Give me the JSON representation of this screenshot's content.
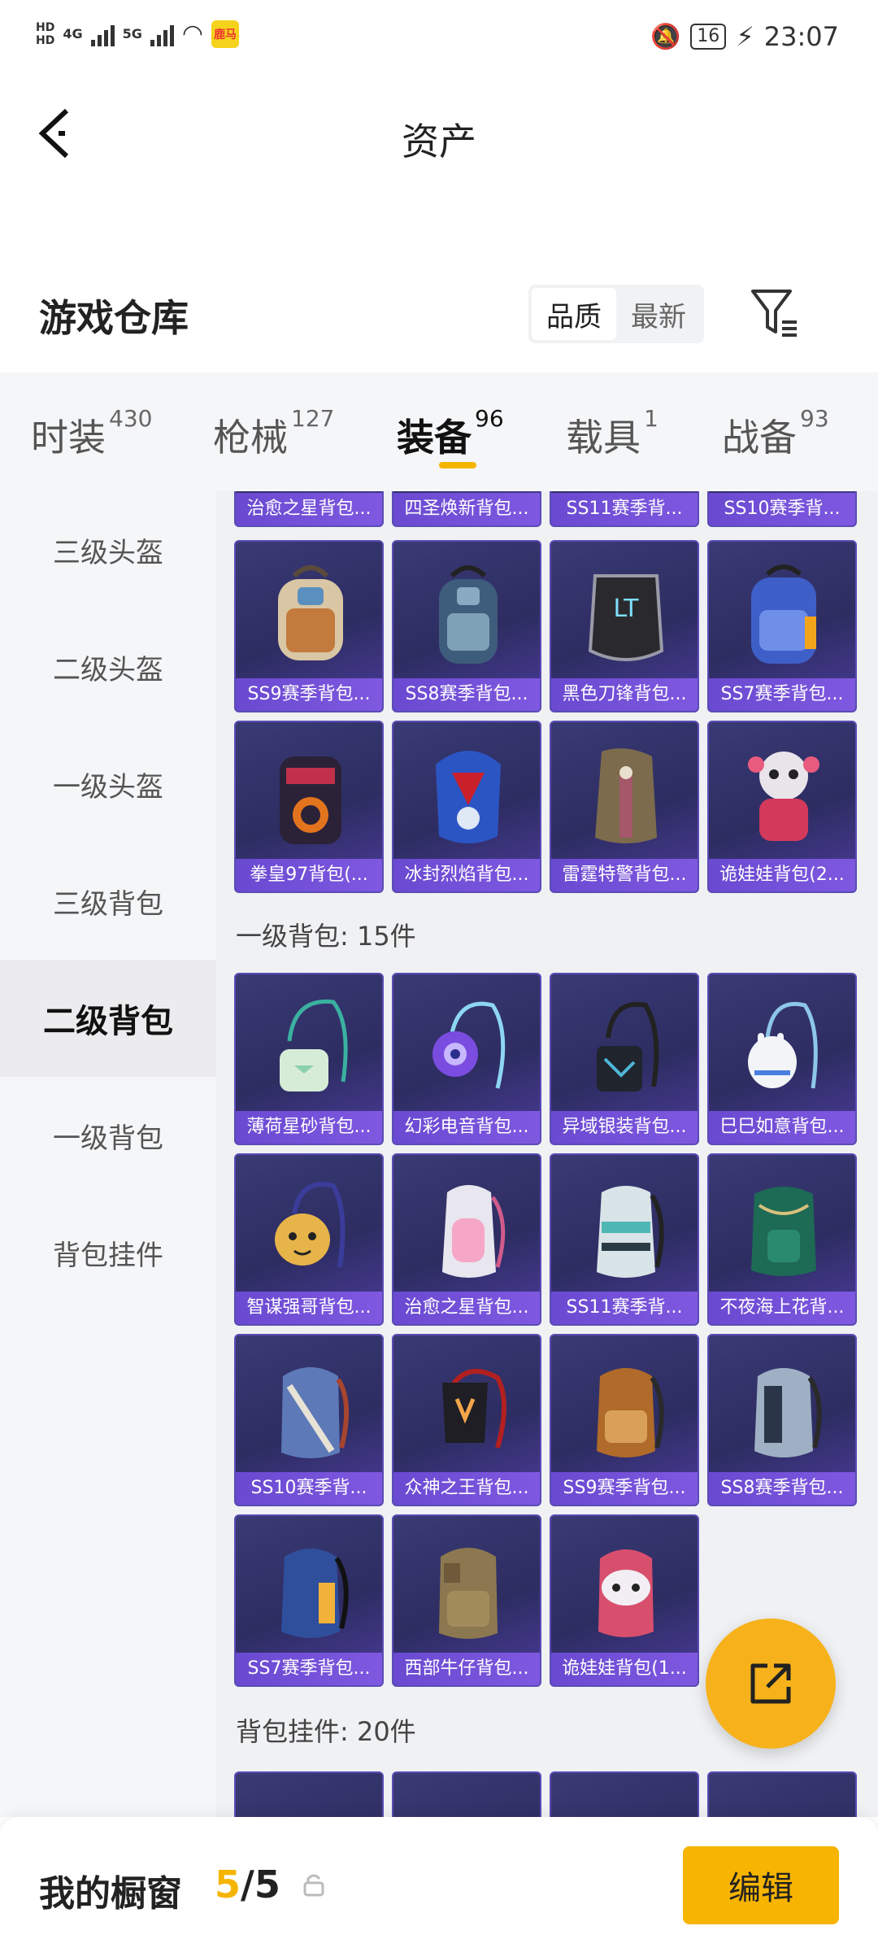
{
  "status_bar": {
    "hd_top": "HD",
    "hd_bottom": "HD",
    "net1": "4G",
    "net2": "5G",
    "app_badge": "鹿马",
    "battery": "16",
    "time": "23:07"
  },
  "header": {
    "title": "资产"
  },
  "warehouse": {
    "title": "游戏仓库",
    "sort_options": [
      "品质",
      "最新"
    ],
    "active_sort": "品质"
  },
  "tabs": [
    {
      "label": "时装",
      "count": "430"
    },
    {
      "label": "枪械",
      "count": "127"
    },
    {
      "label": "装备",
      "count": "96"
    },
    {
      "label": "载具",
      "count": "1"
    },
    {
      "label": "战备",
      "count": "93"
    }
  ],
  "active_tab": "装备",
  "sidebar": {
    "items": [
      "三级头盔",
      "二级头盔",
      "一级头盔",
      "三级背包",
      "二级背包",
      "一级背包",
      "背包挂件"
    ],
    "active": "二级背包"
  },
  "grid": {
    "partial_row": [
      "治愈之星背包...",
      "四圣焕新背包...",
      "SS11赛季背...",
      "SS10赛季背..."
    ],
    "level2_rows": [
      [
        "SS9赛季背包...",
        "SS8赛季背包...",
        "黑色刀锋背包...",
        "SS7赛季背包..."
      ],
      [
        "拳皇97背包(...",
        "冰封烈焰背包...",
        "雷霆特警背包...",
        "诡娃娃背包(2..."
      ]
    ],
    "level1_section": "一级背包: 15件",
    "level1_rows": [
      [
        "薄荷星砂背包...",
        "幻彩电音背包...",
        "异域银装背包...",
        "巳巳如意背包..."
      ],
      [
        "智谋强哥背包...",
        "治愈之星背包...",
        "SS11赛季背...",
        "不夜海上花背..."
      ],
      [
        "SS10赛季背...",
        "众神之王背包...",
        "SS9赛季背包...",
        "SS8赛季背包..."
      ],
      [
        "SS7赛季背包...",
        "西部牛仔背包...",
        "诡娃娃背包(1..."
      ]
    ],
    "charm_section": "背包挂件: 20件"
  },
  "bottom_bar": {
    "title": "我的橱窗",
    "current": "5",
    "separator": "/",
    "total": "5",
    "edit_label": "编辑"
  },
  "colors": {
    "accent": "#f5b400",
    "card_bg": "#2d2d62",
    "card_caption": "#7253d8"
  }
}
